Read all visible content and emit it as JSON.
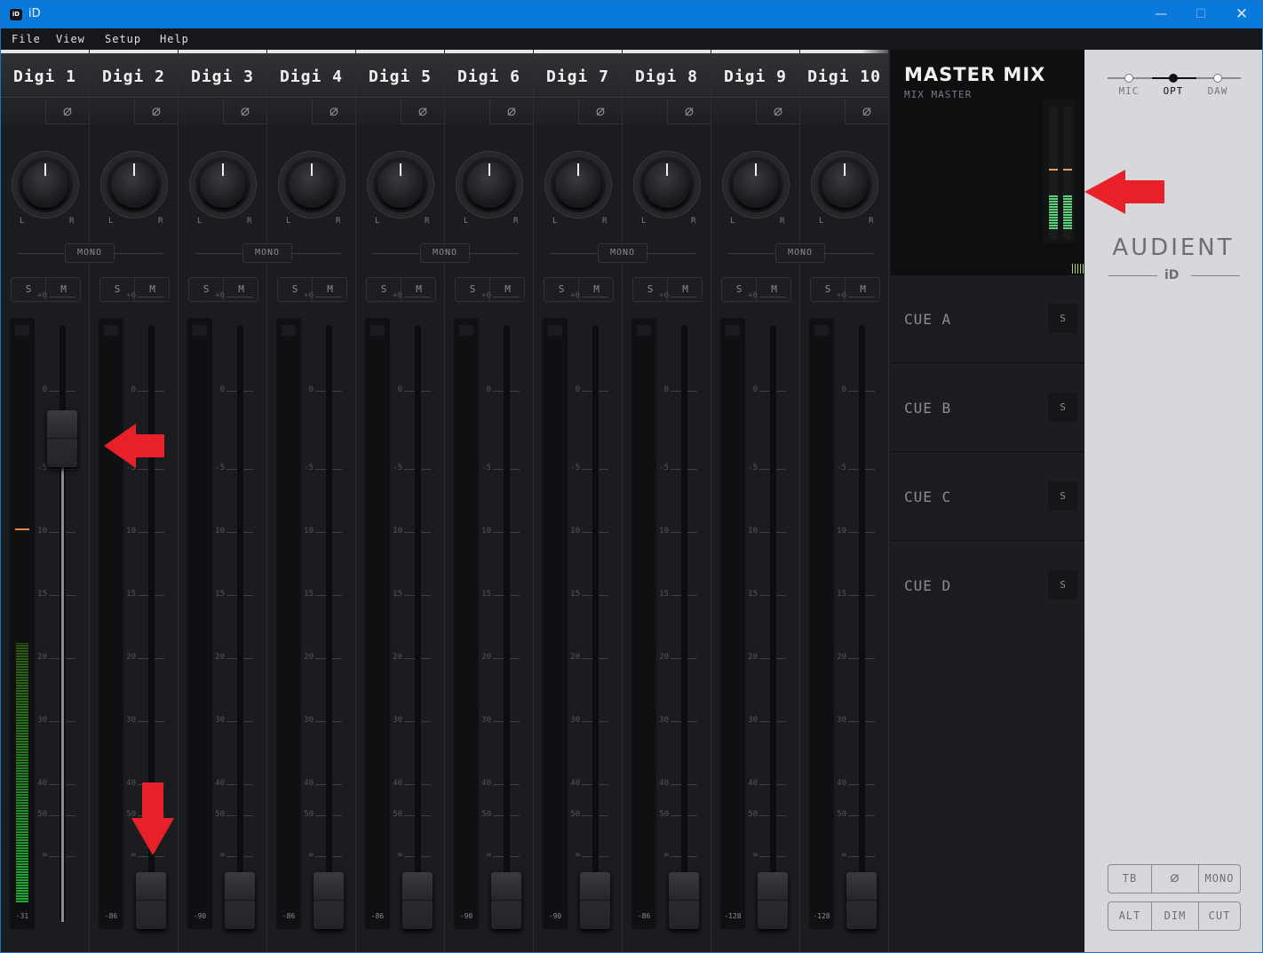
{
  "window": {
    "title": "iD",
    "app_icon_text": "iD",
    "controls": {
      "minimize": "—",
      "maximize": "☐",
      "close": "✕"
    }
  },
  "menu": [
    "File",
    "View",
    "Setup",
    "Help"
  ],
  "phase_icon": "⌀",
  "pan_labels": {
    "left": "L",
    "right": "R"
  },
  "mono_label": "MONO",
  "solo_label": "S",
  "mute_label": "M",
  "fader_scale": [
    "+6",
    "0",
    "-5",
    "10",
    "15",
    "20",
    "30",
    "40",
    "50",
    "∞"
  ],
  "channels": [
    {
      "name": "Digi 1",
      "meter_readout": "-31",
      "fader_position_db": "0",
      "meter_level_fraction": 0.45,
      "peak_hold_db": "-6"
    },
    {
      "name": "Digi 2",
      "meter_readout": "-86",
      "fader_position_db": "-∞",
      "meter_level_fraction": 0
    },
    {
      "name": "Digi 3",
      "meter_readout": "-90",
      "fader_position_db": "-∞",
      "meter_level_fraction": 0
    },
    {
      "name": "Digi 4",
      "meter_readout": "-86",
      "fader_position_db": "-∞",
      "meter_level_fraction": 0
    },
    {
      "name": "Digi 5",
      "meter_readout": "-86",
      "fader_position_db": "-∞",
      "meter_level_fraction": 0
    },
    {
      "name": "Digi 6",
      "meter_readout": "-90",
      "fader_position_db": "-∞",
      "meter_level_fraction": 0
    },
    {
      "name": "Digi 7",
      "meter_readout": "-90",
      "fader_position_db": "-∞",
      "meter_level_fraction": 0
    },
    {
      "name": "Digi 8",
      "meter_readout": "-86",
      "fader_position_db": "-∞",
      "meter_level_fraction": 0
    },
    {
      "name": "Digi 9",
      "meter_readout": "-128",
      "fader_position_db": "-∞",
      "meter_level_fraction": 0
    },
    {
      "name": "Digi 10",
      "meter_readout": "-128",
      "fader_position_db": "-∞",
      "meter_level_fraction": 0
    }
  ],
  "master": {
    "title": "MASTER MIX",
    "subtitle": "MIX MASTER",
    "meter_level_fraction": 0.4
  },
  "cues": [
    {
      "label": "CUE A",
      "solo": "S"
    },
    {
      "label": "CUE B",
      "solo": "S"
    },
    {
      "label": "CUE C",
      "solo": "S"
    },
    {
      "label": "CUE D",
      "solo": "S"
    }
  ],
  "source_selector": {
    "options": [
      "MIC",
      "OPT",
      "DAW"
    ],
    "selected": "OPT"
  },
  "brand": {
    "name": "AUDIENT",
    "model": "iD"
  },
  "monitor_controls": {
    "row1": [
      "TB",
      "⌀",
      "MONO"
    ],
    "row2": [
      "ALT",
      "DIM",
      "CUT"
    ]
  },
  "annotation_color": "#e8202a"
}
